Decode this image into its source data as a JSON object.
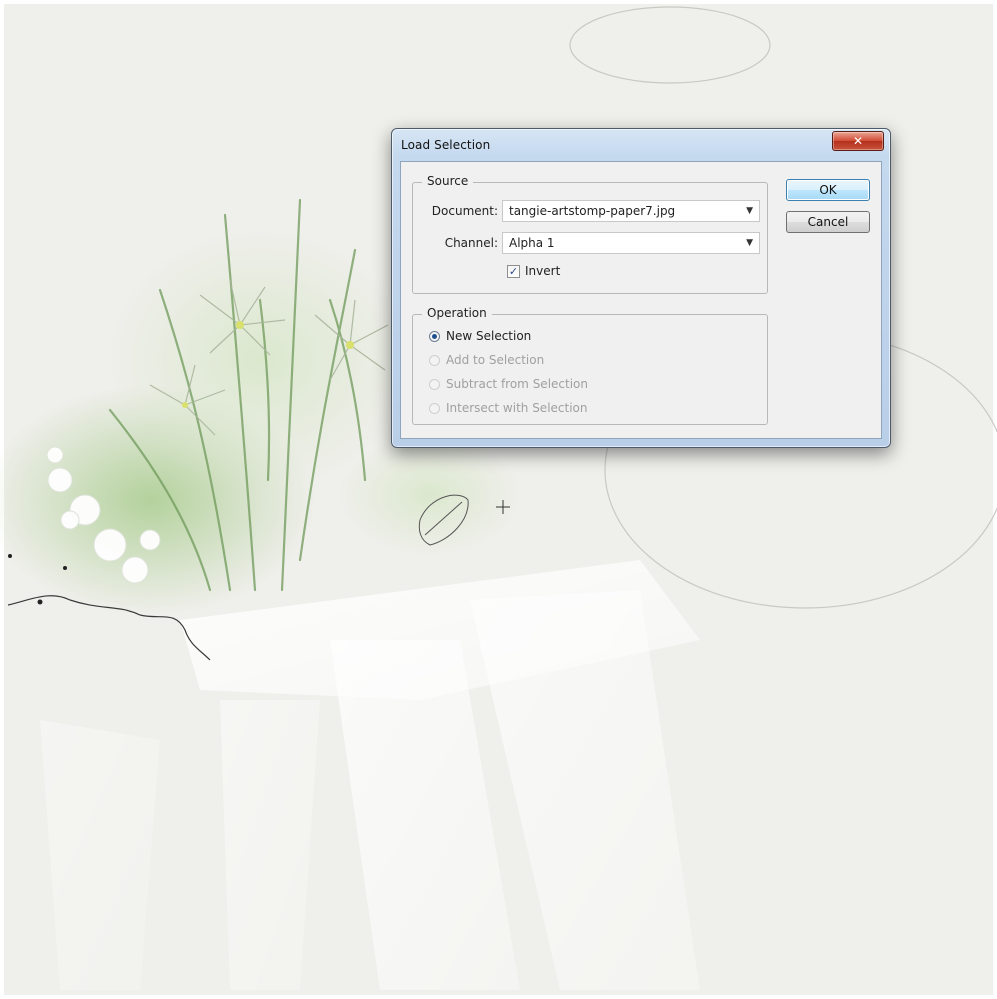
{
  "dialog": {
    "title": "Load Selection",
    "close_symbol": "✕",
    "source": {
      "legend": "Source",
      "document_label": "Document:",
      "document_value": "tangie-artstomp-paper7.jpg",
      "channel_label": "Channel:",
      "channel_value": "Alpha 1",
      "invert_label": "Invert",
      "invert_checked": true
    },
    "operation": {
      "legend": "Operation",
      "options": [
        {
          "label": "New Selection",
          "selected": true,
          "enabled": true
        },
        {
          "label": "Add to Selection",
          "selected": false,
          "enabled": false
        },
        {
          "label": "Subtract from Selection",
          "selected": false,
          "enabled": false
        },
        {
          "label": "Intersect with Selection",
          "selected": false,
          "enabled": false
        }
      ]
    },
    "buttons": {
      "ok": "OK",
      "cancel": "Cancel"
    }
  },
  "colors": {
    "paper": "#efefeb",
    "wash_green": "#a9cc8e",
    "stem_green": "#6f9a5a",
    "window_frame": "#c4d8ee",
    "close_red": "#d14b34"
  }
}
